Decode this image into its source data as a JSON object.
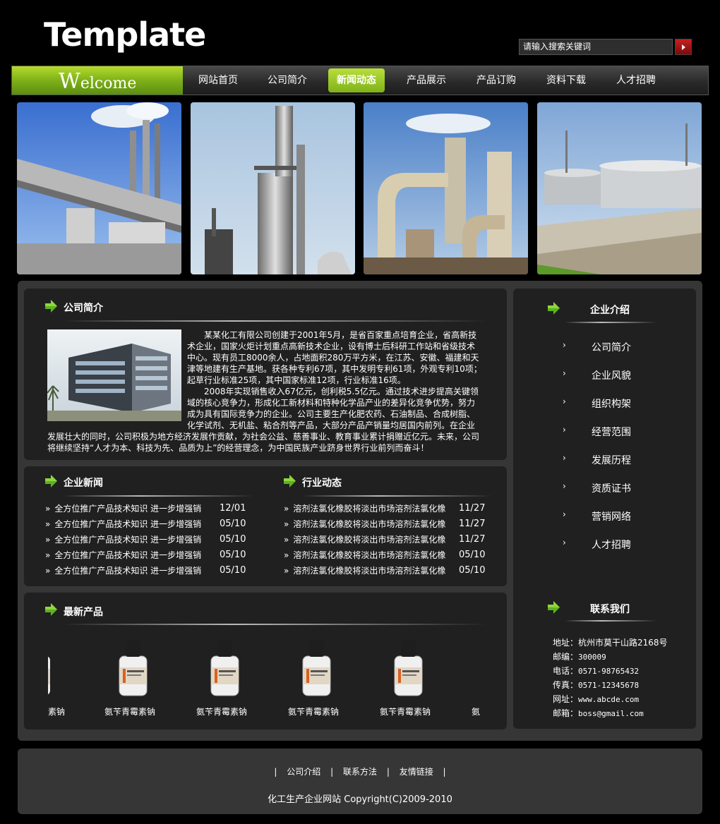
{
  "header": {
    "logo": "Template",
    "search_placeholder": "请输入搜索关键词"
  },
  "nav": {
    "welcome": "Welcome",
    "items": [
      "网站首页",
      "公司简介",
      "新闻动态",
      "产品展示",
      "产品订购",
      "资料下载",
      "人才招聘"
    ],
    "active_index": 2
  },
  "about": {
    "title": "公司简介",
    "paragraph1": "某某化工有限公司创建于2001年5月，是省百家重点培育企业，省高新技术企业，国家火炬计划重点高新技术企业，设有博士后科研工作站和省级技术中心。现有员工8000余人，占地面积280万平方米，在江苏、安徽、福建和天津等地建有生产基地。获各种专利67项，其中发明专利61项，外观专利10项；起草行业标准25项，其中国家标准12项，行业标准16项。",
    "paragraph2": "2008年实现销售收入67亿元，创利税5.5亿元。通过技术进步提高关键领域的核心竞争力，形成化工新材料和特种化学品产业的差异化竞争优势，努力成为具有国际竞争力的企业。公司主要生产化肥农药、石油制品、合成树脂、化学试剂、无机盐、粘合剂等产品，大部分产品产销量均居国内前列。在企业发展壮大的同时，公司积极为地方经济发展作贡献，为社会公益、慈善事业、教育事业累计捐赠近亿元。未来，公司将继续坚持“人才为本、科技为先、品质为上”的经营理念，为中国民族产业跻身世界行业前列而奋斗！"
  },
  "company_news": {
    "title": "企业新闻",
    "items": [
      {
        "text": "全方位推广产品技术知识  进一步增强销",
        "date": "12/01"
      },
      {
        "text": "全方位推广产品技术知识  进一步增强销",
        "date": "05/10"
      },
      {
        "text": "全方位推广产品技术知识  进一步增强销",
        "date": "05/10"
      },
      {
        "text": "全方位推广产品技术知识  进一步增强销",
        "date": "05/10"
      },
      {
        "text": "全方位推广产品技术知识  进一步增强销",
        "date": "05/10"
      }
    ]
  },
  "industry_news": {
    "title": "行业动态",
    "items": [
      {
        "text": "溶剂法氯化橡胶将淡出市场溶剂法氯化橡",
        "date": "11/27"
      },
      {
        "text": "溶剂法氯化橡胶将淡出市场溶剂法氯化橡",
        "date": "11/27"
      },
      {
        "text": "溶剂法氯化橡胶将淡出市场溶剂法氯化橡",
        "date": "11/27"
      },
      {
        "text": "溶剂法氯化橡胶将淡出市场溶剂法氯化橡",
        "date": "05/10"
      },
      {
        "text": "溶剂法氯化橡胶将淡出市场溶剂法氯化橡",
        "date": "05/10"
      }
    ]
  },
  "products": {
    "title": "最新产品",
    "partial_left": "素钠",
    "partial_right": "氨",
    "items": [
      "氨苄青霉素钠",
      "氨苄青霉素钠",
      "氨苄青霉素钠",
      "氨苄青霉素钠"
    ]
  },
  "sidebar": {
    "title": "企业介绍",
    "items": [
      "公司简介",
      "企业风貌",
      "组织构架",
      "经营范围",
      "发展历程",
      "资质证书",
      "营销网络",
      "人才招聘"
    ]
  },
  "contact": {
    "title": "联系我们",
    "address": "地址：杭州市莫干山路2168号",
    "zip_label": "邮编：",
    "zip": "300009",
    "tel_label": "电话：",
    "tel": "0571-98765432",
    "fax_label": "传真：",
    "fax": "0571-12345678",
    "web_label": "网址：",
    "web": "www.abcde.com",
    "email_label": "邮箱：",
    "email": "boss@gmail.com"
  },
  "footer": {
    "links": [
      "公司介绍",
      "联系方法",
      "友情链接"
    ],
    "copyright": "化工生产企业网站  Copyright(C)2009-2010"
  },
  "colors": {
    "accent_green": "#8fc21e",
    "background": "#000000",
    "panel": "#202020",
    "container": "#363636",
    "search_button": "#a01515"
  }
}
